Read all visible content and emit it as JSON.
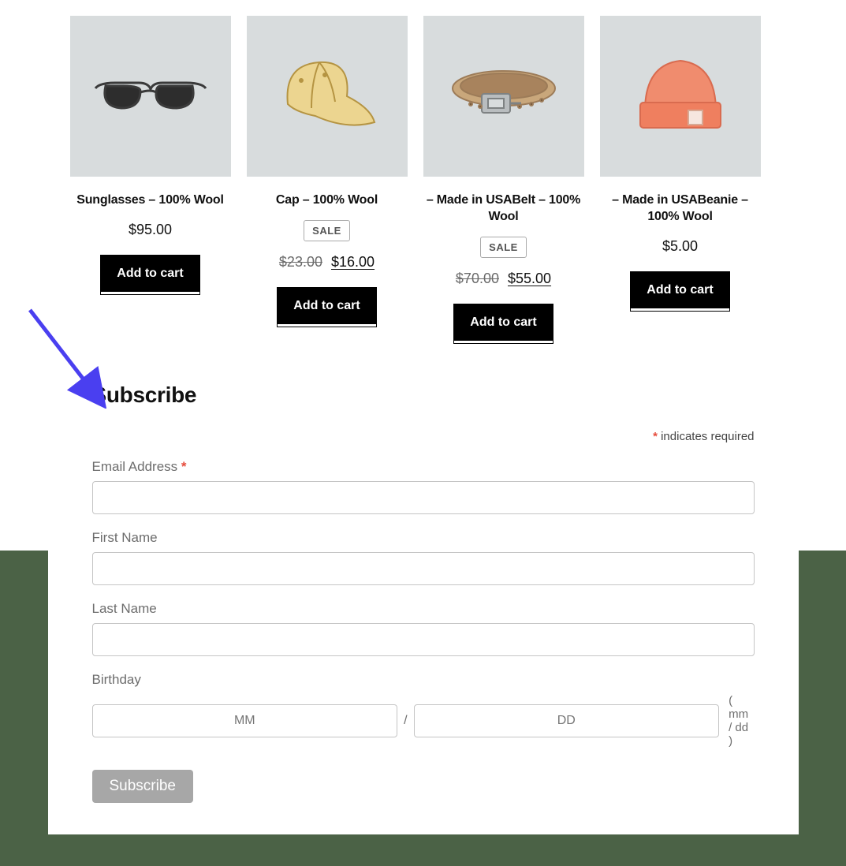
{
  "products": [
    {
      "title": "Sunglasses – 100% Wool",
      "sale": false,
      "old_price": "",
      "price": "$95.00",
      "cta": "Add to cart"
    },
    {
      "title": "Cap – 100% Wool",
      "sale": true,
      "sale_label": "SALE",
      "old_price": "$23.00",
      "price": "$16.00",
      "cta": "Add to cart"
    },
    {
      "title": "– Made in USABelt – 100% Wool",
      "sale": true,
      "sale_label": "SALE",
      "old_price": "$70.00",
      "price": "$55.00",
      "cta": "Add to cart"
    },
    {
      "title": "– Made in USABeanie – 100% Wool",
      "sale": false,
      "old_price": "",
      "price": "$5.00",
      "cta": "Add to cart"
    }
  ],
  "subscribe": {
    "heading": "Subscribe",
    "required_note": "indicates required",
    "email_label": "Email Address",
    "first_name_label": "First Name",
    "last_name_label": "Last Name",
    "birthday_label": "Birthday",
    "mm_placeholder": "MM",
    "dd_placeholder": "DD",
    "bday_hint": "( mm / dd )",
    "submit_label": "Subscribe"
  }
}
